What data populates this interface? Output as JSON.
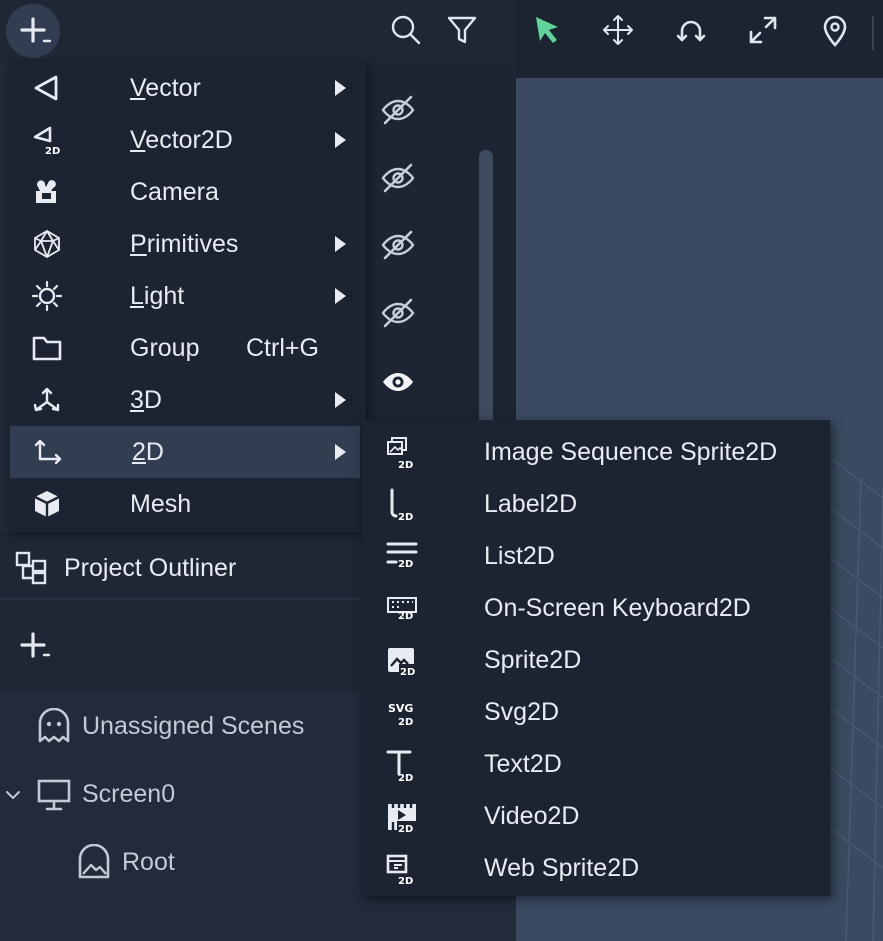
{
  "toolbar": {
    "add_icon": "plus-icon",
    "search_icon": "search-icon",
    "filter_icon": "filter-icon",
    "select_icon": "cursor-arrow-icon",
    "move_icon": "move-arrows-icon",
    "rotate_icon": "rotate-icon",
    "scale_icon": "expand-icon",
    "pin_icon": "map-pin-icon",
    "accent_color": "#5fd39a"
  },
  "menu": {
    "items": [
      {
        "label": "Vector",
        "underline": "V",
        "rest": "ector",
        "icon": "vector-icon",
        "has_submenu": true
      },
      {
        "label": "Vector2D",
        "underline": "V",
        "rest": "ector2D",
        "icon": "vector2d-icon",
        "has_submenu": true
      },
      {
        "label": "Camera",
        "icon": "camera-icon",
        "has_submenu": false
      },
      {
        "label": "Primitives",
        "underline": "P",
        "rest": "rimitives",
        "icon": "icosahedron-icon",
        "has_submenu": true
      },
      {
        "label": "Light",
        "underline": "L",
        "rest": "ight",
        "icon": "sun-icon",
        "has_submenu": true
      },
      {
        "label": "Group",
        "shortcut": "Ctrl+G",
        "icon": "folder-icon",
        "has_submenu": false
      },
      {
        "label": "3D",
        "underline": "3",
        "rest": "D",
        "icon": "axes-3d-icon",
        "has_submenu": true
      },
      {
        "label": "2D",
        "underline": "2",
        "rest": "D",
        "icon": "axes-2d-icon",
        "has_submenu": true,
        "active": true
      },
      {
        "label": "Mesh",
        "icon": "cube-icon",
        "has_submenu": false
      }
    ]
  },
  "submenu": {
    "badge": "2D",
    "items": [
      {
        "label": "Image Sequence Sprite2D",
        "icon": "image-sequence-2d-icon"
      },
      {
        "label": "Label2D",
        "icon": "label-2d-icon"
      },
      {
        "label": "List2D",
        "icon": "list-2d-icon"
      },
      {
        "label": "On-Screen Keyboard2D",
        "icon": "keyboard-2d-icon"
      },
      {
        "label": "Sprite2D",
        "icon": "sprite-2d-icon"
      },
      {
        "label": "Svg2D",
        "icon": "svg-2d-icon",
        "icon_text": "SVG"
      },
      {
        "label": "Text2D",
        "icon": "text-2d-icon"
      },
      {
        "label": "Video2D",
        "icon": "video-2d-icon"
      },
      {
        "label": "Web Sprite2D",
        "icon": "web-sprite-2d-icon"
      }
    ]
  },
  "visibility_icons": [
    "eye-off-icon",
    "eye-off-icon",
    "eye-off-icon",
    "eye-off-icon",
    "eye-icon"
  ],
  "outliner": {
    "title": "Project Outliner",
    "add_icon": "plus-icon",
    "tree": [
      {
        "label": "Unassigned Scenes",
        "icon": "ghost-icon"
      },
      {
        "label": "Screen0",
        "icon": "monitor-icon",
        "expanded": true
      },
      {
        "label": "Root",
        "icon": "scene-root-icon"
      }
    ]
  }
}
